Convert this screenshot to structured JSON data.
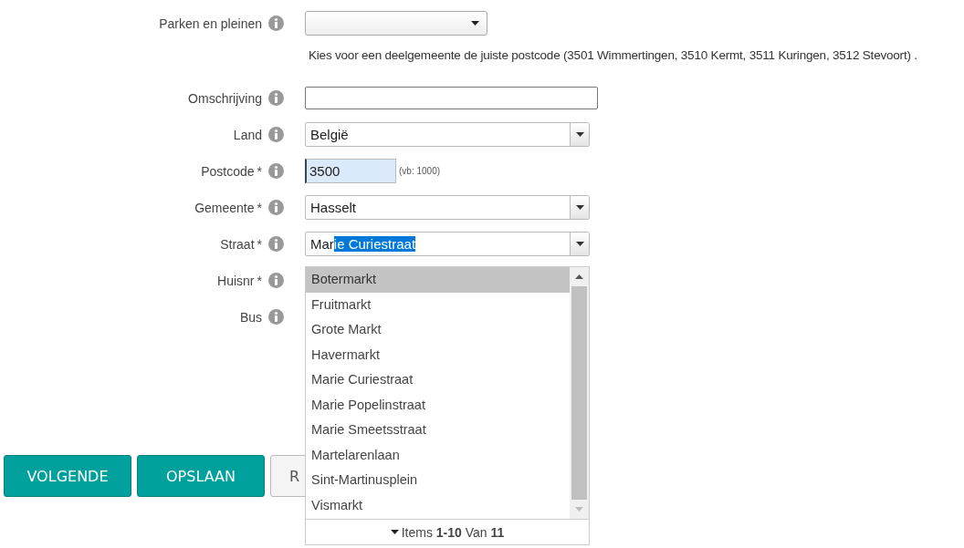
{
  "fields": [
    {
      "label": "Parken en pleinen",
      "kind": "select"
    },
    {
      "kind": "hint",
      "text": "Kies voor een deelgemeente de juiste postcode (3501 Wimmertingen, 3510 Kermt, 3511 Kuringen, 3512 Stevoort) ."
    },
    {
      "label": "Omschrijving",
      "kind": "text"
    },
    {
      "label": "Land",
      "kind": "combo",
      "value": "België"
    },
    {
      "label": "Postcode",
      "required_mark": "*",
      "kind": "postcode",
      "value": "3500",
      "example": "(vb: 1000)"
    },
    {
      "label": "Gemeente",
      "required_mark": "*",
      "kind": "combo",
      "value": "Hasselt"
    },
    {
      "label": "Straat",
      "required_mark": "*",
      "kind": "autocomplete",
      "value": "Mar",
      "completion": "ie Curiestraat"
    },
    {
      "label": "Huisnr",
      "required_mark": "*",
      "kind": "hidden"
    },
    {
      "label": "Bus",
      "kind": "hidden"
    }
  ],
  "dropdown": {
    "items": [
      {
        "label": "Botermarkt",
        "selected": true
      },
      {
        "label": "Fruitmarkt",
        "selected": false
      },
      {
        "label": "Grote Markt",
        "selected": false
      },
      {
        "label": "Havermarkt",
        "selected": false
      },
      {
        "label": "Marie Curiestraat",
        "selected": false
      },
      {
        "label": "Marie Popelinstraat",
        "selected": false
      },
      {
        "label": "Marie Smeetsstraat",
        "selected": false
      },
      {
        "label": "Martelarenlaan",
        "selected": false
      },
      {
        "label": "Sint-Martinusplein",
        "selected": false
      },
      {
        "label": "Vismarkt",
        "selected": false
      }
    ],
    "footer": "Items **1-10** Van **11**"
  },
  "buttons": [
    {
      "label": "VOLGENDE",
      "kind": "primary"
    },
    {
      "label": "OPSLAAN",
      "kind": "primary"
    },
    {
      "label": "R",
      "kind": "secondary"
    }
  ]
}
